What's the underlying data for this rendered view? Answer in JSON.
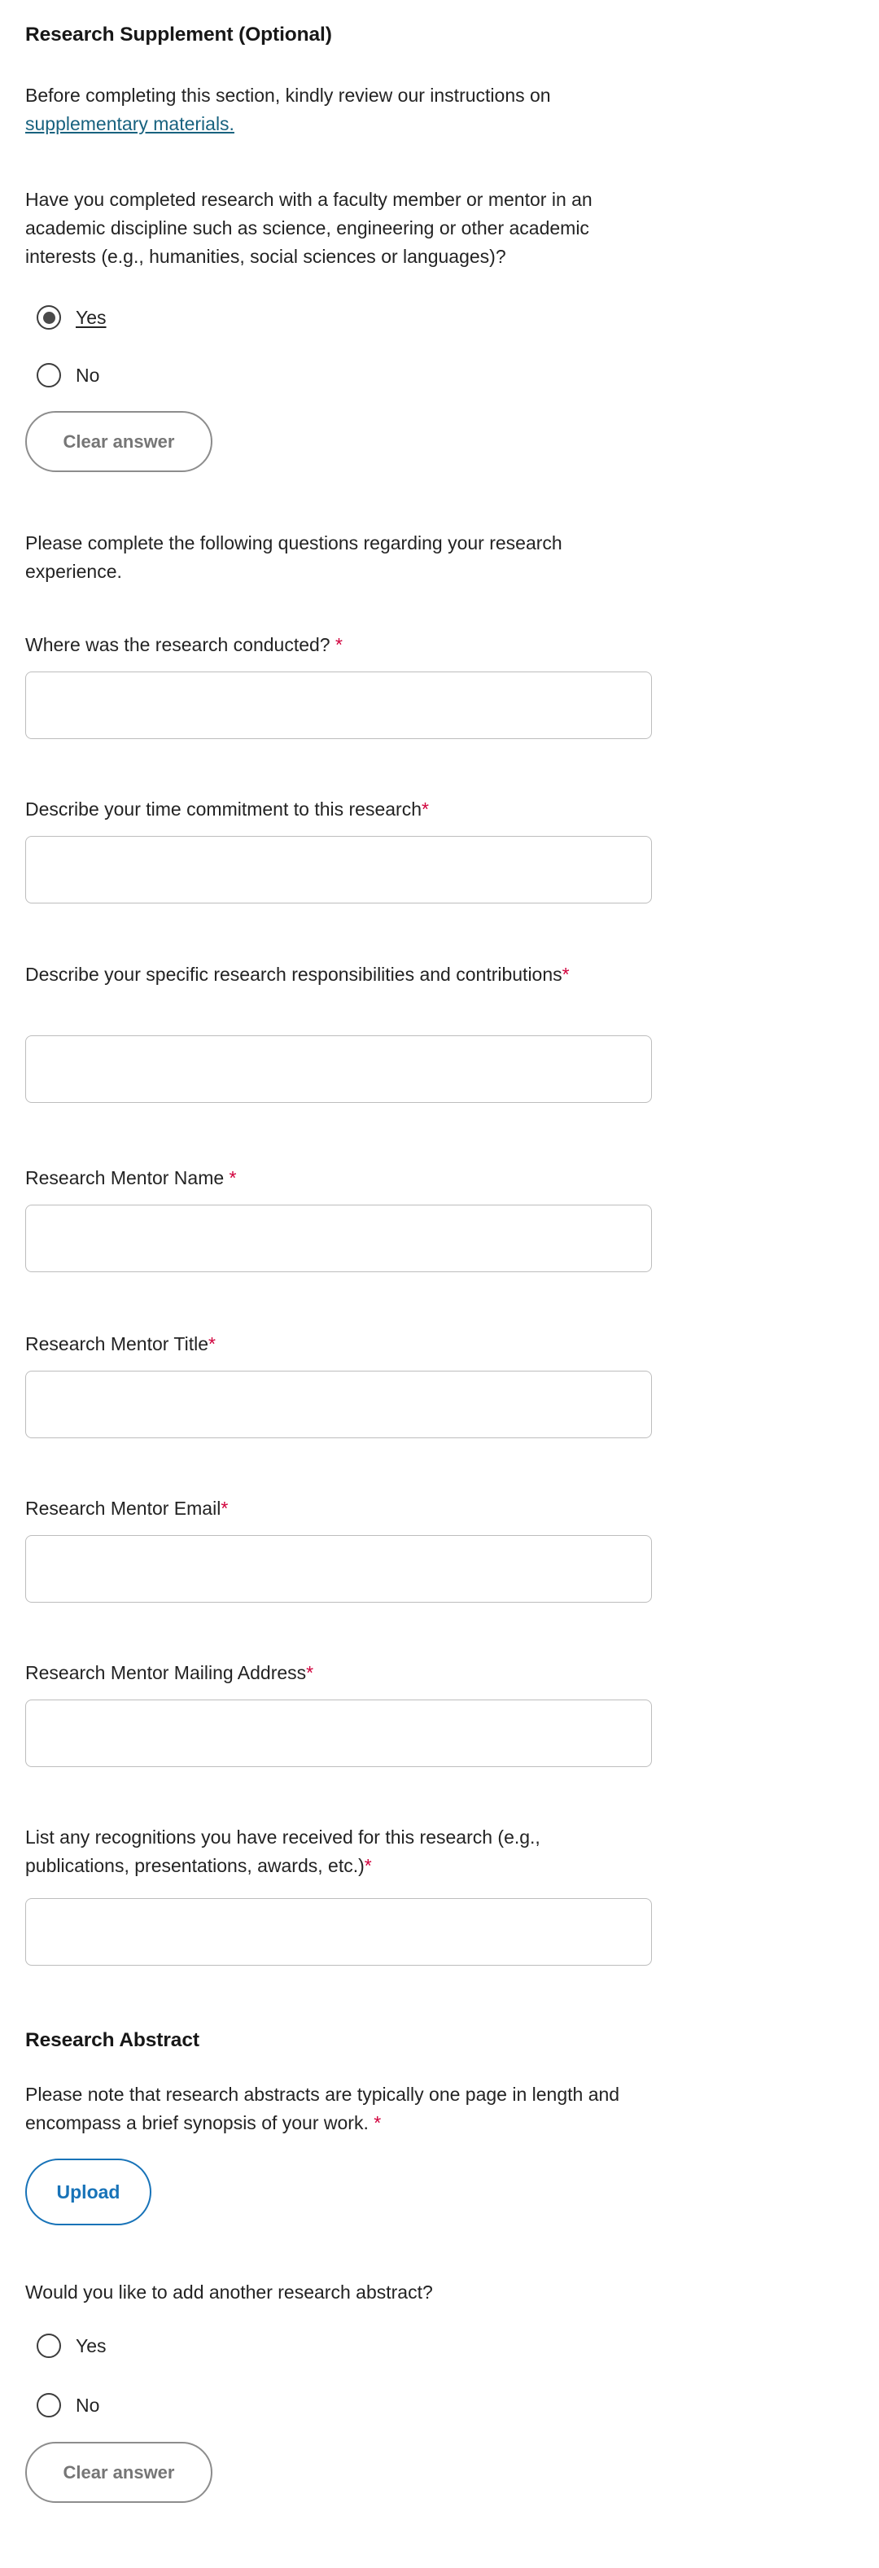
{
  "section": {
    "title": "Research Supplement (Optional)",
    "intro_line1": "Before completing this section, kindly review our instructions on",
    "intro_link": "supplementary materials.",
    "question_main": "Have you completed research with a faculty member or mentor in an academic discipline such as science, engineering or other academic interests (e.g., humanities, social sciences or languages)?",
    "instruction": "Please complete the following questions regarding your research experience."
  },
  "radio_group_main": {
    "options": [
      {
        "label": "Yes",
        "checked": true,
        "underlined": true
      },
      {
        "label": "No",
        "checked": false,
        "underlined": false
      }
    ],
    "clear_button": "Clear answer"
  },
  "fields": [
    {
      "label": "Where was the research conducted?",
      "required_mark": " *",
      "value": "",
      "placeholder": ""
    },
    {
      "label": "Describe your time commitment to this research",
      "required_mark": "*",
      "value": "",
      "placeholder": ""
    },
    {
      "label": "Describe your specific research responsibilities and contributions",
      "required_mark": "*",
      "value": "",
      "placeholder": ""
    },
    {
      "label": "Research Mentor Name",
      "required_mark": " *",
      "value": "",
      "placeholder": ""
    },
    {
      "label": "Research Mentor Title",
      "required_mark": "*",
      "value": "",
      "placeholder": ""
    },
    {
      "label": "Research Mentor Email",
      "required_mark": "*",
      "value": "",
      "placeholder": ""
    },
    {
      "label": "Research Mentor Mailing Address",
      "required_mark": "*",
      "value": "",
      "placeholder": ""
    },
    {
      "label": "List any recognitions you have received for this research (e.g., publications, presentations, awards, etc.)",
      "required_mark": "*",
      "value": "",
      "placeholder": ""
    }
  ],
  "abstract": {
    "heading": "Research Abstract",
    "note": "Please note that research abstracts are typically one page in length and encompass a brief synopsis of your work.",
    "note_required_mark": " *",
    "upload_button": "Upload"
  },
  "radio_group_another": {
    "question": "Would you like to add another research abstract?",
    "options": [
      {
        "label": "Yes",
        "checked": false,
        "underlined": false
      },
      {
        "label": "No",
        "checked": false,
        "underlined": false
      }
    ],
    "clear_button": "Clear answer"
  },
  "colors": {
    "required_asterisk": "#d1003c",
    "link": "#18627f",
    "upload_accent": "#1873b8",
    "clear_border": "#8d8d8d",
    "input_border": "#bdbdbd",
    "text": "#232323"
  }
}
